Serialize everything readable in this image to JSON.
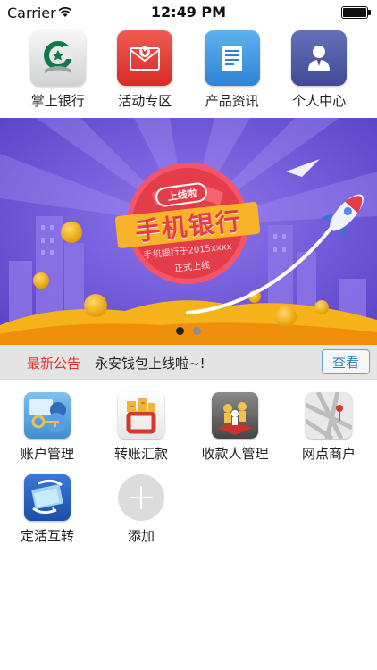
{
  "status_bar": {
    "carrier": "Carrier",
    "time": "12:49 PM",
    "battery_level": 1.0
  },
  "top_menu": [
    {
      "label": "掌上银行",
      "icon": "bank-logo-icon"
    },
    {
      "label": "活动专区",
      "icon": "promotion-envelope-icon"
    },
    {
      "label": "产品资讯",
      "icon": "document-news-icon"
    },
    {
      "label": "个人中心",
      "icon": "person-icon"
    }
  ],
  "banner": {
    "badge": "上线啦",
    "title": "手机银行",
    "line1": "手机银行于2015xxxx",
    "line2": "正式上线",
    "page_count": 2,
    "active_page": 1,
    "colors": {
      "background": "#6e56d6",
      "badge": "#e53c4a",
      "hill": "#f5b21a"
    }
  },
  "notice": {
    "tag": "最新公告",
    "text": "永安钱包上线啦~!",
    "button": "查看"
  },
  "features": [
    {
      "label": "账户管理",
      "icon": "account-key-icon"
    },
    {
      "label": "转账汇款",
      "icon": "transfer-icon"
    },
    {
      "label": "收款人管理",
      "icon": "payee-people-icon"
    },
    {
      "label": "网点商户",
      "icon": "map-pin-icon"
    },
    {
      "label": "定活互转",
      "icon": "deposit-convert-icon"
    },
    {
      "label": "添加",
      "icon": "add-icon"
    }
  ],
  "colors": {
    "notice_tag": "#e0302a",
    "notice_button": "#2d7fb3"
  }
}
